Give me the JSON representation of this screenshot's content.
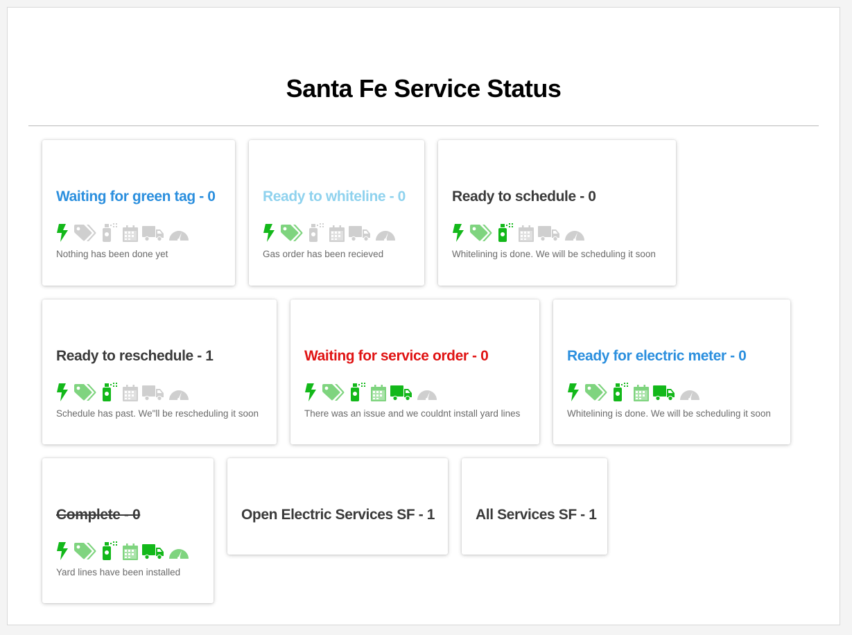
{
  "page": {
    "title": "Santa Fe Service Status"
  },
  "colors": {
    "green": "#13b81a",
    "light_green": "#7fd47f",
    "gray": "#cfcfcf",
    "blue": "#2b8fde",
    "light_blue": "#8fd2ee",
    "red": "#e01414",
    "dark": "#3a3a3a"
  },
  "icon_names": [
    "bolt-icon",
    "tag-icon",
    "spray-can-icon",
    "calendar-icon",
    "truck-icon",
    "gauge-icon"
  ],
  "cards": [
    {
      "title": "Waiting for green tag - 0",
      "description": "Nothing has been done yet",
      "title_color": "blue",
      "icon_states": [
        "green",
        "gray",
        "gray",
        "gray",
        "gray",
        "gray"
      ]
    },
    {
      "title": "Ready to whiteline - 0",
      "description": "Gas order has been recieved",
      "title_color": "light_blue",
      "icon_states": [
        "green",
        "light_green",
        "gray",
        "gray",
        "gray",
        "gray"
      ]
    },
    {
      "title": "Ready to schedule - 0",
      "description": "Whitelining is done. We will be scheduling it soon",
      "title_color": "dark",
      "icon_states": [
        "green",
        "light_green",
        "green",
        "gray",
        "gray",
        "gray"
      ]
    },
    {
      "title": "Ready to reschedule - 1",
      "description": "Schedule has past. We\"ll be rescheduling it soon",
      "title_color": "dark",
      "icon_states": [
        "green",
        "light_green",
        "green",
        "gray",
        "gray",
        "gray"
      ]
    },
    {
      "title": "Waiting for service order - 0",
      "description": "There was an issue and we couldnt install yard lines",
      "title_color": "red",
      "icon_states": [
        "green",
        "light_green",
        "green",
        "light_green",
        "green",
        "gray"
      ]
    },
    {
      "title": "Ready for electric meter - 0",
      "description": "Whitelining is done. We will be scheduling it soon",
      "title_color": "blue",
      "icon_states": [
        "green",
        "light_green",
        "green",
        "light_green",
        "green",
        "gray"
      ]
    },
    {
      "title": "Complete - 0",
      "description": "Yard lines have been installed",
      "title_color": "dark",
      "strikethrough": true,
      "icon_states": [
        "green",
        "light_green",
        "green",
        "light_green",
        "green",
        "light_green"
      ]
    },
    {
      "title": "Open Electric Services SF - 1",
      "title_color": "dark"
    },
    {
      "title": "All Services SF - 1",
      "title_color": "dark"
    }
  ]
}
